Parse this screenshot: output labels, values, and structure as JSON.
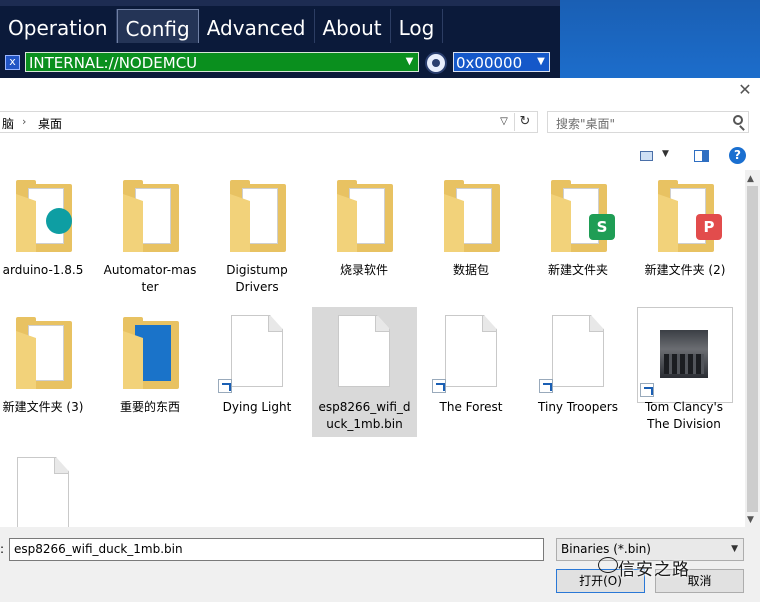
{
  "app": {
    "tabs": [
      "Operation",
      "Config",
      "Advanced",
      "About",
      "Log"
    ],
    "active_tab": "Config",
    "port_value": "INTERNAL://NODEMCU",
    "address_value": "0x00000",
    "x_label": "x"
  },
  "dialog": {
    "breadcrumb": [
      "脑",
      "桌面"
    ],
    "search_placeholder": "搜索\"桌面\"",
    "items": [
      {
        "label": "arduino-1.8.5",
        "kind": "folder",
        "badge": "",
        "badge_color": "#0e9ea3"
      },
      {
        "label": "Automator-mas\nter",
        "kind": "folder",
        "badge": "",
        "badge_color": ""
      },
      {
        "label": "Digistump\nDrivers",
        "kind": "folder",
        "badge": "",
        "badge_color": ""
      },
      {
        "label": "烧录软件",
        "kind": "folder",
        "badge": "",
        "badge_color": "#3a8fc8"
      },
      {
        "label": "数据包",
        "kind": "folder",
        "badge": "",
        "badge_color": "#3a8fc8"
      },
      {
        "label": "新建文件夹",
        "kind": "folder",
        "badge": "S",
        "badge_color": "#1f9d55"
      },
      {
        "label": "新建文件夹 (2)",
        "kind": "folder",
        "badge": "P",
        "badge_color": "#e24c4c"
      },
      {
        "label": "新建文件夹 (3)",
        "kind": "folder",
        "badge": "",
        "badge_color": "#3a78d0"
      },
      {
        "label": "重要的东西",
        "kind": "folder",
        "badge": "",
        "badge_color": "#1a73c9"
      },
      {
        "label": "Dying Light",
        "kind": "shortcut",
        "badge": "",
        "badge_color": ""
      },
      {
        "label": "esp8266_wifi_d\nuck_1mb.bin",
        "kind": "file-selected",
        "badge": "",
        "badge_color": ""
      },
      {
        "label": "The Forest",
        "kind": "shortcut",
        "badge": "",
        "badge_color": ""
      },
      {
        "label": "Tiny Troopers",
        "kind": "shortcut",
        "badge": "",
        "badge_color": ""
      },
      {
        "label": "Tom Clancy's\nThe Division",
        "kind": "image-shortcut",
        "badge": "",
        "badge_color": ""
      },
      {
        "label": "",
        "kind": "file",
        "badge": "",
        "badge_color": ""
      }
    ],
    "filename_label": ":",
    "filename_value": "esp8266_wifi_duck_1mb.bin",
    "filetype_value": "Binaries (*.bin)",
    "open_button": "打开(O)",
    "cancel_button": "取消",
    "watermark": "信安之路"
  }
}
